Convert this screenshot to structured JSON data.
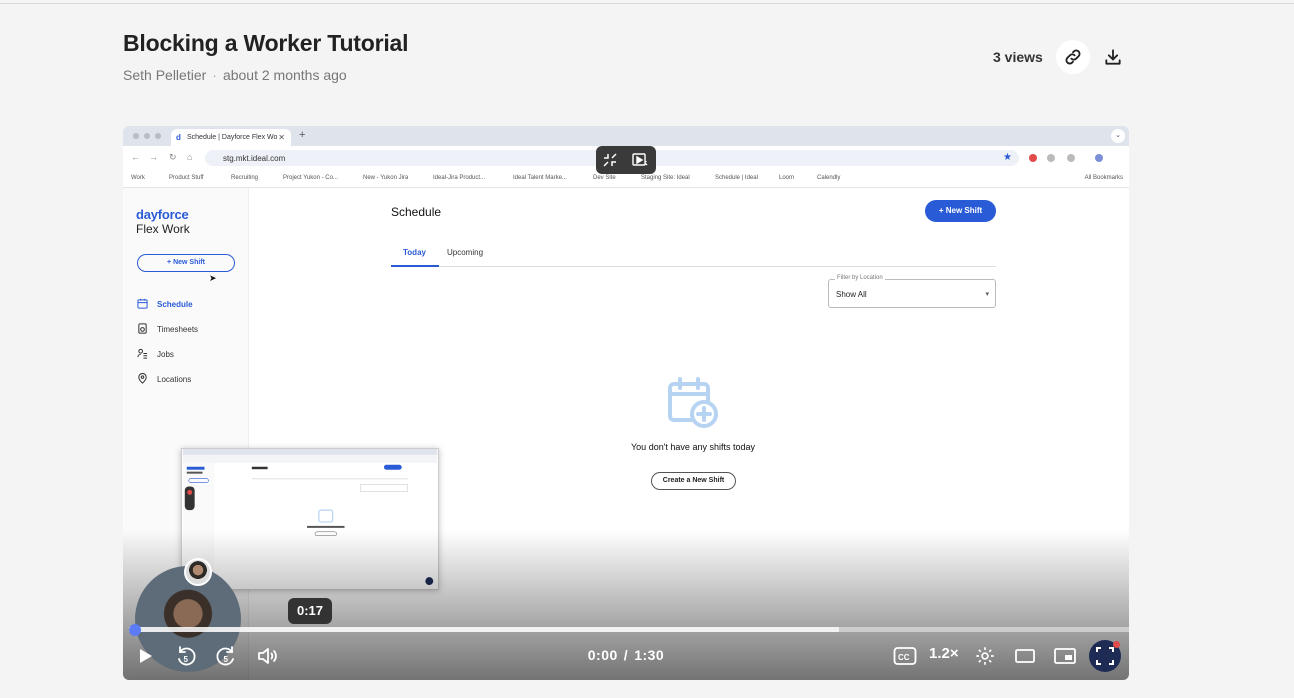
{
  "page": {
    "title": "Blocking a Worker Tutorial",
    "author": "Seth Pelletier",
    "posted": "about 2 months ago",
    "views": "3 views"
  },
  "browser": {
    "tab_title": "Schedule | Dayforce Flex Wo",
    "new_tab": "+",
    "url": "stg.mkt.ideal.com",
    "bookmarks": [
      "Work",
      "Product Stuff",
      "Recruiting",
      "Project Yukon - Co...",
      "New - Yukon Jira",
      "Ideal-Jira Product...",
      "Ideal Talent Marke...",
      "Dev Site",
      "Staging Site: Ideal",
      "Schedule | Ideal",
      "Loom",
      "Calendly"
    ],
    "all_bookmarks": "All Bookmarks"
  },
  "app": {
    "logo_line1": "dayforce",
    "logo_line2": "Flex Work",
    "sidebar_new": "New Shift",
    "nav": [
      {
        "label": "Schedule",
        "icon": "calendar-icon",
        "active": true
      },
      {
        "label": "Timesheets",
        "icon": "timesheet-icon",
        "active": false
      },
      {
        "label": "Jobs",
        "icon": "jobs-icon",
        "active": false
      },
      {
        "label": "Locations",
        "icon": "location-pin-icon",
        "active": false
      }
    ],
    "heading": "Schedule",
    "new_shift_button": "New Shift",
    "tabs": [
      "Today",
      "Upcoming"
    ],
    "filter_label": "Filter by Location",
    "filter_value": "Show All",
    "empty_message": "You don't have any shifts today",
    "create_button": "Create a New Shift"
  },
  "player": {
    "hover_time": "0:17",
    "current_time": "0:00",
    "duration": "1:30",
    "speed": "1.2×",
    "progress_fraction": 0.0,
    "buffered_fraction": 0.71,
    "accent": "#5b7cf5",
    "brand_blue": "#2a5bd7"
  }
}
